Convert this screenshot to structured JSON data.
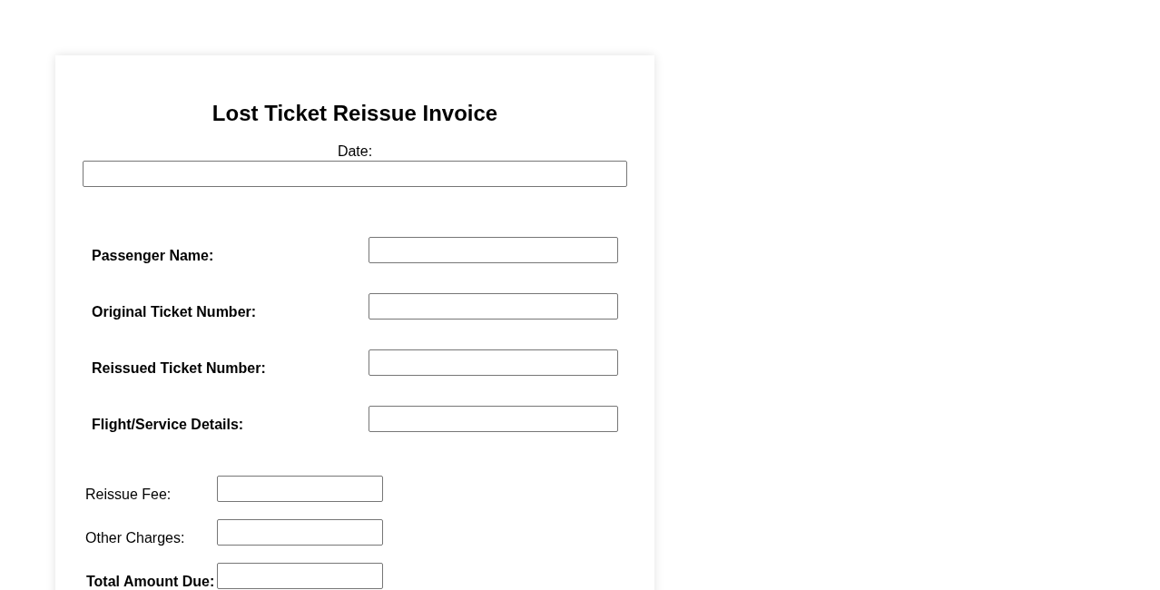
{
  "title": "Lost Ticket Reissue Invoice",
  "date": {
    "label": "Date:"
  },
  "details": [
    {
      "label": "Passenger Name:"
    },
    {
      "label": "Original Ticket Number:"
    },
    {
      "label": "Reissued Ticket Number:"
    },
    {
      "label": "Flight/Service Details:"
    }
  ],
  "charges": [
    {
      "label": "Reissue Fee:",
      "kind": "line"
    },
    {
      "label": "Other Charges:",
      "kind": "line"
    },
    {
      "label": "Total Amount Due:",
      "kind": "total"
    }
  ]
}
